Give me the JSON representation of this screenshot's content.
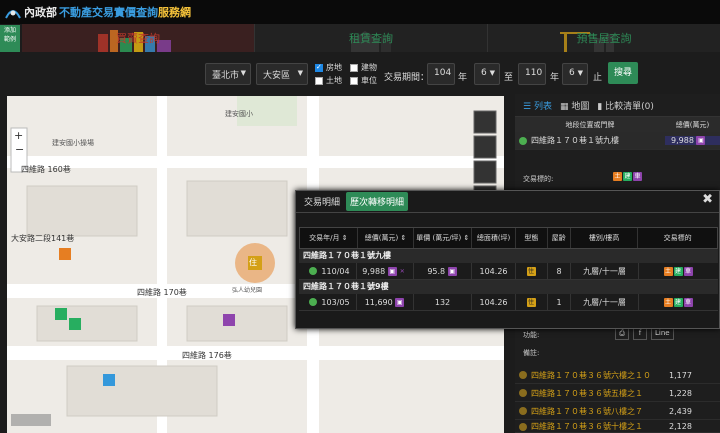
{
  "header": {
    "brand_ministry": "內政部",
    "brand_main": "不動產交易實價查詢",
    "brand_suffix": "服務網"
  },
  "side_button": {
    "line1": "添加",
    "line2": "範例"
  },
  "tabs": [
    {
      "label": "買賣查詢"
    },
    {
      "label": "租賃查詢"
    },
    {
      "label": "預售屋查詢"
    }
  ],
  "filters": {
    "city": "臺北市",
    "district": "大安區",
    "types": [
      {
        "label": "房地",
        "checked": true
      },
      {
        "label": "建物",
        "checked": false
      },
      {
        "label": "土地",
        "checked": false
      },
      {
        "label": "車位",
        "checked": false
      }
    ],
    "period_label": "交易期間：",
    "start_year": "104",
    "start_month": "6",
    "end_year": "110",
    "end_month": "6",
    "year_unit": "年",
    "to_label": "至",
    "end_label": "止",
    "search_label": "搜尋"
  },
  "map": {
    "labels": {
      "park": "建安國小",
      "school": "建安國小操場",
      "lane160": "四維路 160巷",
      "lane170": "四維路 170巷",
      "lane176": "四維路 176巷",
      "road_dun": "大安路二段141巷",
      "park2": "弘人幼兒園",
      "marker": "住"
    }
  },
  "right_panel": {
    "tab_list": "列表",
    "tab_map": "地圖",
    "tab_compare": "比較清單(0)",
    "col_address": "地段位置或門牌",
    "col_price": "總價(萬元)",
    "selected_address": "四維路１７０巷１號九樓",
    "selected_price": "9,988",
    "target_label": "交易標的:",
    "function_label": "功能:",
    "note_label": "備註:",
    "line_label": "Line",
    "list": [
      {
        "address": "四維路１７０巷３６號六樓之１０",
        "price": "1,177"
      },
      {
        "address": "四維路１７０巷３６號五樓之１",
        "price": "1,228"
      },
      {
        "address": "四維路１７０巷３６號八樓之７",
        "price": "2,439"
      },
      {
        "address": "四維路１７０巷３６號十樓之１",
        "price": "2,128"
      }
    ]
  },
  "popup": {
    "tab_detail": "交易明細",
    "tab_history": "歷次轉移明細",
    "columns": [
      "交易年/月",
      "總價(萬元)",
      "單價 (萬元/坪)",
      "總面積(坪)",
      "型態",
      "屋齡",
      "樓別/樓高",
      "交易標的"
    ],
    "groups": [
      {
        "title": "四維路１７０巷１號九樓",
        "row": {
          "date": "110/04",
          "price": "9,988",
          "unit": "95.8",
          "area": "104.26",
          "age": "8",
          "floor": "九層/十一層"
        }
      },
      {
        "title": "四維路１７０巷１號9樓",
        "row": {
          "date": "103/05",
          "price": "11,690",
          "unit": "132",
          "area": "104.26",
          "age": "1",
          "floor": "九層/十一層"
        }
      }
    ]
  }
}
